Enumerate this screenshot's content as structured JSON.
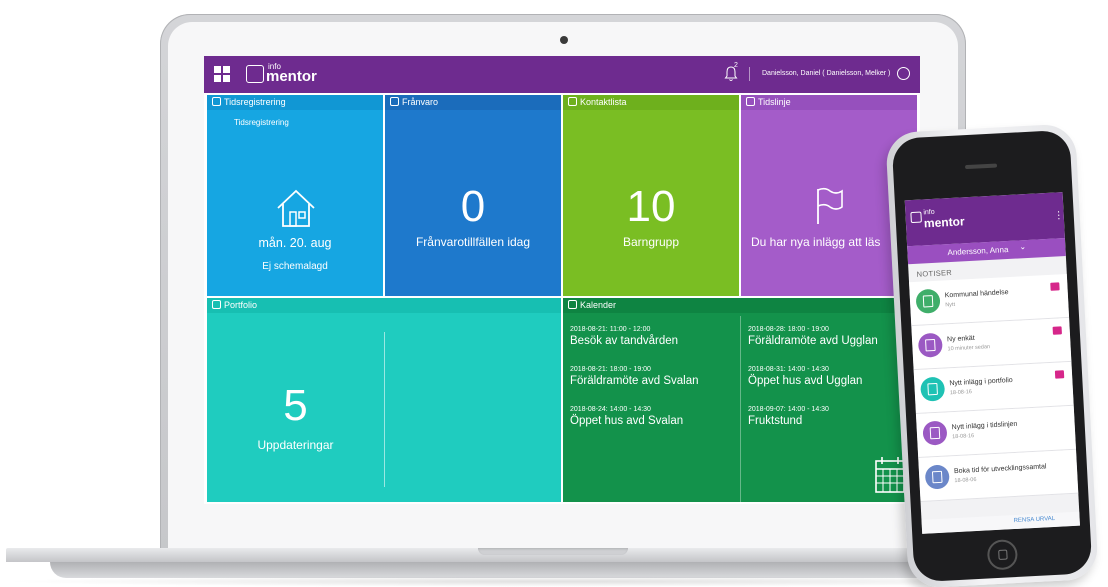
{
  "topbar": {
    "logo_small": "info",
    "logo_big": "mentor",
    "notification_count": "2",
    "user_name": "Danielsson, Daniel ( Danielsson, Melker )"
  },
  "tiles": {
    "tidsregistrering": {
      "header": "Tidsregistrering",
      "label": "Tidsregistrering",
      "date": "mån. 20. aug",
      "status": "Ej schemalagd"
    },
    "franvaro": {
      "header": "Frånvaro",
      "count": "0",
      "label": "Frånvarotillfällen idag"
    },
    "kontaktlista": {
      "header": "Kontaktlista",
      "count": "10",
      "label": "Barngrupp"
    },
    "tidslinje": {
      "header": "Tidslinje",
      "label": "Du har nya inlägg att läs"
    },
    "portfolio": {
      "header": "Portfolio",
      "count": "5",
      "label": "Uppdateringar"
    },
    "kalender": {
      "header": "Kalender",
      "events": [
        {
          "time": "2018-08-21: 11:00 - 12:00",
          "title": "Besök av tandvården"
        },
        {
          "time": "2018-08-21: 18:00 - 19:00",
          "title": "Föräldramöte avd Svalan"
        },
        {
          "time": "2018-08-24: 14:00 - 14:30",
          "title": "Öppet hus avd Svalan"
        },
        {
          "time": "2018-08-28: 18:00 - 19:00",
          "title": "Föräldramöte avd Ugglan"
        },
        {
          "time": "2018-08-31: 14:00 - 14:30",
          "title": "Öppet hus avd Ugglan"
        },
        {
          "time": "2018-09-07: 14:00 - 14:30",
          "title": "Fruktstund"
        }
      ]
    }
  },
  "phone": {
    "logo_small": "info",
    "logo_big": "mentor",
    "user": "Andersson, Anna",
    "section": "NOTISER",
    "items": [
      {
        "title": "Kommunal händelse",
        "date": "Nytt",
        "icon": "calendar-icon",
        "color": "#3fae6a",
        "badge": true
      },
      {
        "title": "Ny enkät",
        "date": "10 minuter sedan",
        "icon": "document-icon",
        "color": "#9b59c3",
        "badge": true
      },
      {
        "title": "Nytt inlägg i portfolio",
        "date": "18-08-16",
        "icon": "portfolio-icon",
        "color": "#1fc2b4",
        "badge": true
      },
      {
        "title": "Nytt inlägg i tidslinjen",
        "date": "18-08-16",
        "icon": "chat-icon",
        "color": "#9b59c3",
        "badge": false
      },
      {
        "title": "Boka tid för utvecklingssamtal",
        "date": "18-08-06",
        "icon": "clock-icon",
        "color": "#6b87c9",
        "badge": false
      }
    ],
    "footer_action": "RENSA URVAL"
  }
}
